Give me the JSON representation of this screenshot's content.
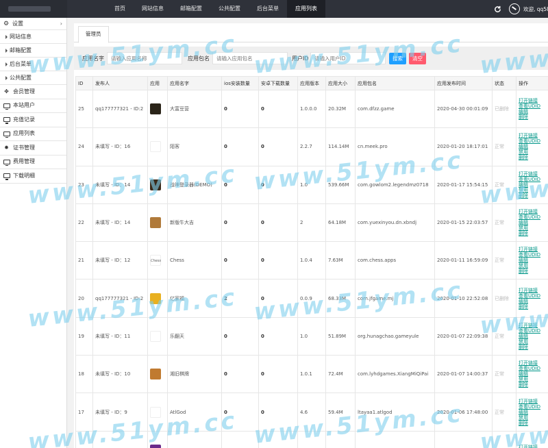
{
  "topbar": {
    "nav": [
      "首页",
      "网站信息",
      "邮箱配置",
      "公共配置",
      "后台菜单",
      "应用列表"
    ],
    "active_nav": "应用列表",
    "welcome": "欢迎, qq585"
  },
  "sidebar": {
    "settings_group": "设置",
    "settings_items": [
      "网站信息",
      "邮箱配置",
      "后台菜单",
      "公共配置"
    ],
    "member_group": "会员管理",
    "items": [
      "本站用户",
      "充值记录",
      "应用列表",
      "证书管理",
      "费用管理",
      "下载明细"
    ]
  },
  "tab": "管理员",
  "search": {
    "name_label": "应用名字",
    "name_placeholder": "请输入应用名称",
    "pkg_label": "应用包名",
    "pkg_placeholder": "请输入应用包名",
    "uid_label": "用户ID",
    "uid_placeholder": "请输入用户ID",
    "search_btn": "搜索",
    "clear_btn": "清空"
  },
  "table": {
    "headers": [
      "ID",
      "发布人",
      "应用",
      "应用名字",
      "ios安装数量",
      "安卓下载数量",
      "应用版本",
      "应用大小",
      "应用包名",
      "应用发布时间",
      "状态",
      "操作"
    ],
    "rows": [
      {
        "id": "25",
        "publisher": "qq177777321 - ID:2",
        "name": "大富豆营",
        "ios": "0",
        "android": "0",
        "version": "1.0.0.0",
        "size": "20.32M",
        "pkg": "com.dfzz.game",
        "time": "2020-04-30 00:01:09",
        "status": "已删除",
        "ops": [
          "打开链接",
          "查看UDID",
          "编辑",
          "",
          "删除"
        ],
        "icon_color": "#2a2418"
      },
      {
        "id": "24",
        "publisher": "未填写 - ID：16",
        "name": "陌客",
        "ios": "0",
        "android": "0",
        "version": "2.2.7",
        "size": "114.14M",
        "pkg": "cn.meek.pro",
        "time": "2020-01-20 18:17:01",
        "status": "正常",
        "ops": [
          "打开链接",
          "查看UDID",
          "编辑",
          "禁用",
          "删除"
        ],
        "icon_color": "#ffffff"
      },
      {
        "id": "23",
        "publisher": "未填写 - ID：14",
        "name": "战神登录器(DEMO)",
        "ios": "0",
        "android": "0",
        "version": "1.0",
        "size": "539.66M",
        "pkg": "com.gowlom2.legendmz0718",
        "time": "2020-01-17 15:54:15",
        "status": "正常",
        "ops": [
          "打开链接",
          "查看UDID",
          "编辑",
          "禁用",
          "删除"
        ],
        "icon_color": "#3a2a1a"
      },
      {
        "id": "22",
        "publisher": "未填写 - ID：14",
        "name": "新版牛大吉",
        "ios": "0",
        "android": "0",
        "version": "2",
        "size": "64.18M",
        "pkg": "com.yuexinyou.dn.xbndj",
        "time": "2020-01-15 22:03:57",
        "status": "正常",
        "ops": [
          "打开链接",
          "查看UDID",
          "编辑",
          "禁用",
          "删除"
        ],
        "icon_color": "#b07a3a"
      },
      {
        "id": "21",
        "publisher": "未填写 - ID：12",
        "name": "Chess",
        "ios": "0",
        "android": "0",
        "version": "1.0.4",
        "size": "7.63M",
        "pkg": "com.chess.apps",
        "time": "2020-01-11 16:59:09",
        "status": "正常",
        "ops": [
          "打开链接",
          "查看UDID",
          "编辑",
          "禁用",
          "删除"
        ],
        "icon_color": "#ffffff",
        "icon_text": "Chess"
      },
      {
        "id": "20",
        "publisher": "qq177777321 - ID:2",
        "name": "亿家福",
        "ios": "2",
        "android": "0",
        "version": "0.0.9",
        "size": "68.33M",
        "pkg": "com.jfgame.mj",
        "time": "2020-01-10 22:52:08",
        "status": "已删除",
        "ops": [
          "打开链接",
          "查看UDID",
          "编辑",
          "",
          "删除"
        ],
        "icon_color": "#e8b020"
      },
      {
        "id": "19",
        "publisher": "未填写 - ID：11",
        "name": "乐翻天",
        "ios": "0",
        "android": "0",
        "version": "1.0",
        "size": "51.89M",
        "pkg": "org.hunagchao.gameyule",
        "time": "2020-01-07 22:09:38",
        "status": "正常",
        "ops": [
          "打开链接",
          "查看UDID",
          "编辑",
          "禁用",
          "删除"
        ],
        "icon_color": "#ffffff"
      },
      {
        "id": "18",
        "publisher": "未填写 - ID：10",
        "name": "湘旧棋牌",
        "ios": "0",
        "android": "0",
        "version": "1.0.1",
        "size": "72.4M",
        "pkg": "com.lyhdgames.XiangMiQiPai",
        "time": "2020-01-07 14:00:37",
        "status": "正常",
        "ops": [
          "打开链接",
          "查看UDID",
          "编辑",
          "禁用",
          "删除"
        ],
        "icon_color": "#c07a30"
      },
      {
        "id": "17",
        "publisher": "未填写 - ID：9",
        "name": "AtlGod",
        "ios": "0",
        "android": "0",
        "version": "4.6",
        "size": "59.4M",
        "pkg": "ltayaa1.atlgod",
        "time": "2020-01-06 17:48:00",
        "status": "正常",
        "ops": [
          "打开链接",
          "查看UDID",
          "编辑",
          "禁用",
          "删除"
        ],
        "icon_color": "#ffffff"
      },
      {
        "id": "",
        "publisher": "",
        "name": "",
        "ios": "",
        "android": "",
        "version": "",
        "size": "",
        "pkg": "",
        "time": "",
        "status": "",
        "ops": [
          "打开链接",
          "查看UDID",
          "",
          "",
          ""
        ],
        "icon_color": "#6a2a8a"
      }
    ]
  },
  "watermark": "www.51ym.cc",
  "colors": {
    "topbar": "#2f323a",
    "link": "#009688",
    "search_btn": "#1e9fff",
    "clear_btn": "#ff5a6e",
    "watermark": "#7fd0ee"
  }
}
